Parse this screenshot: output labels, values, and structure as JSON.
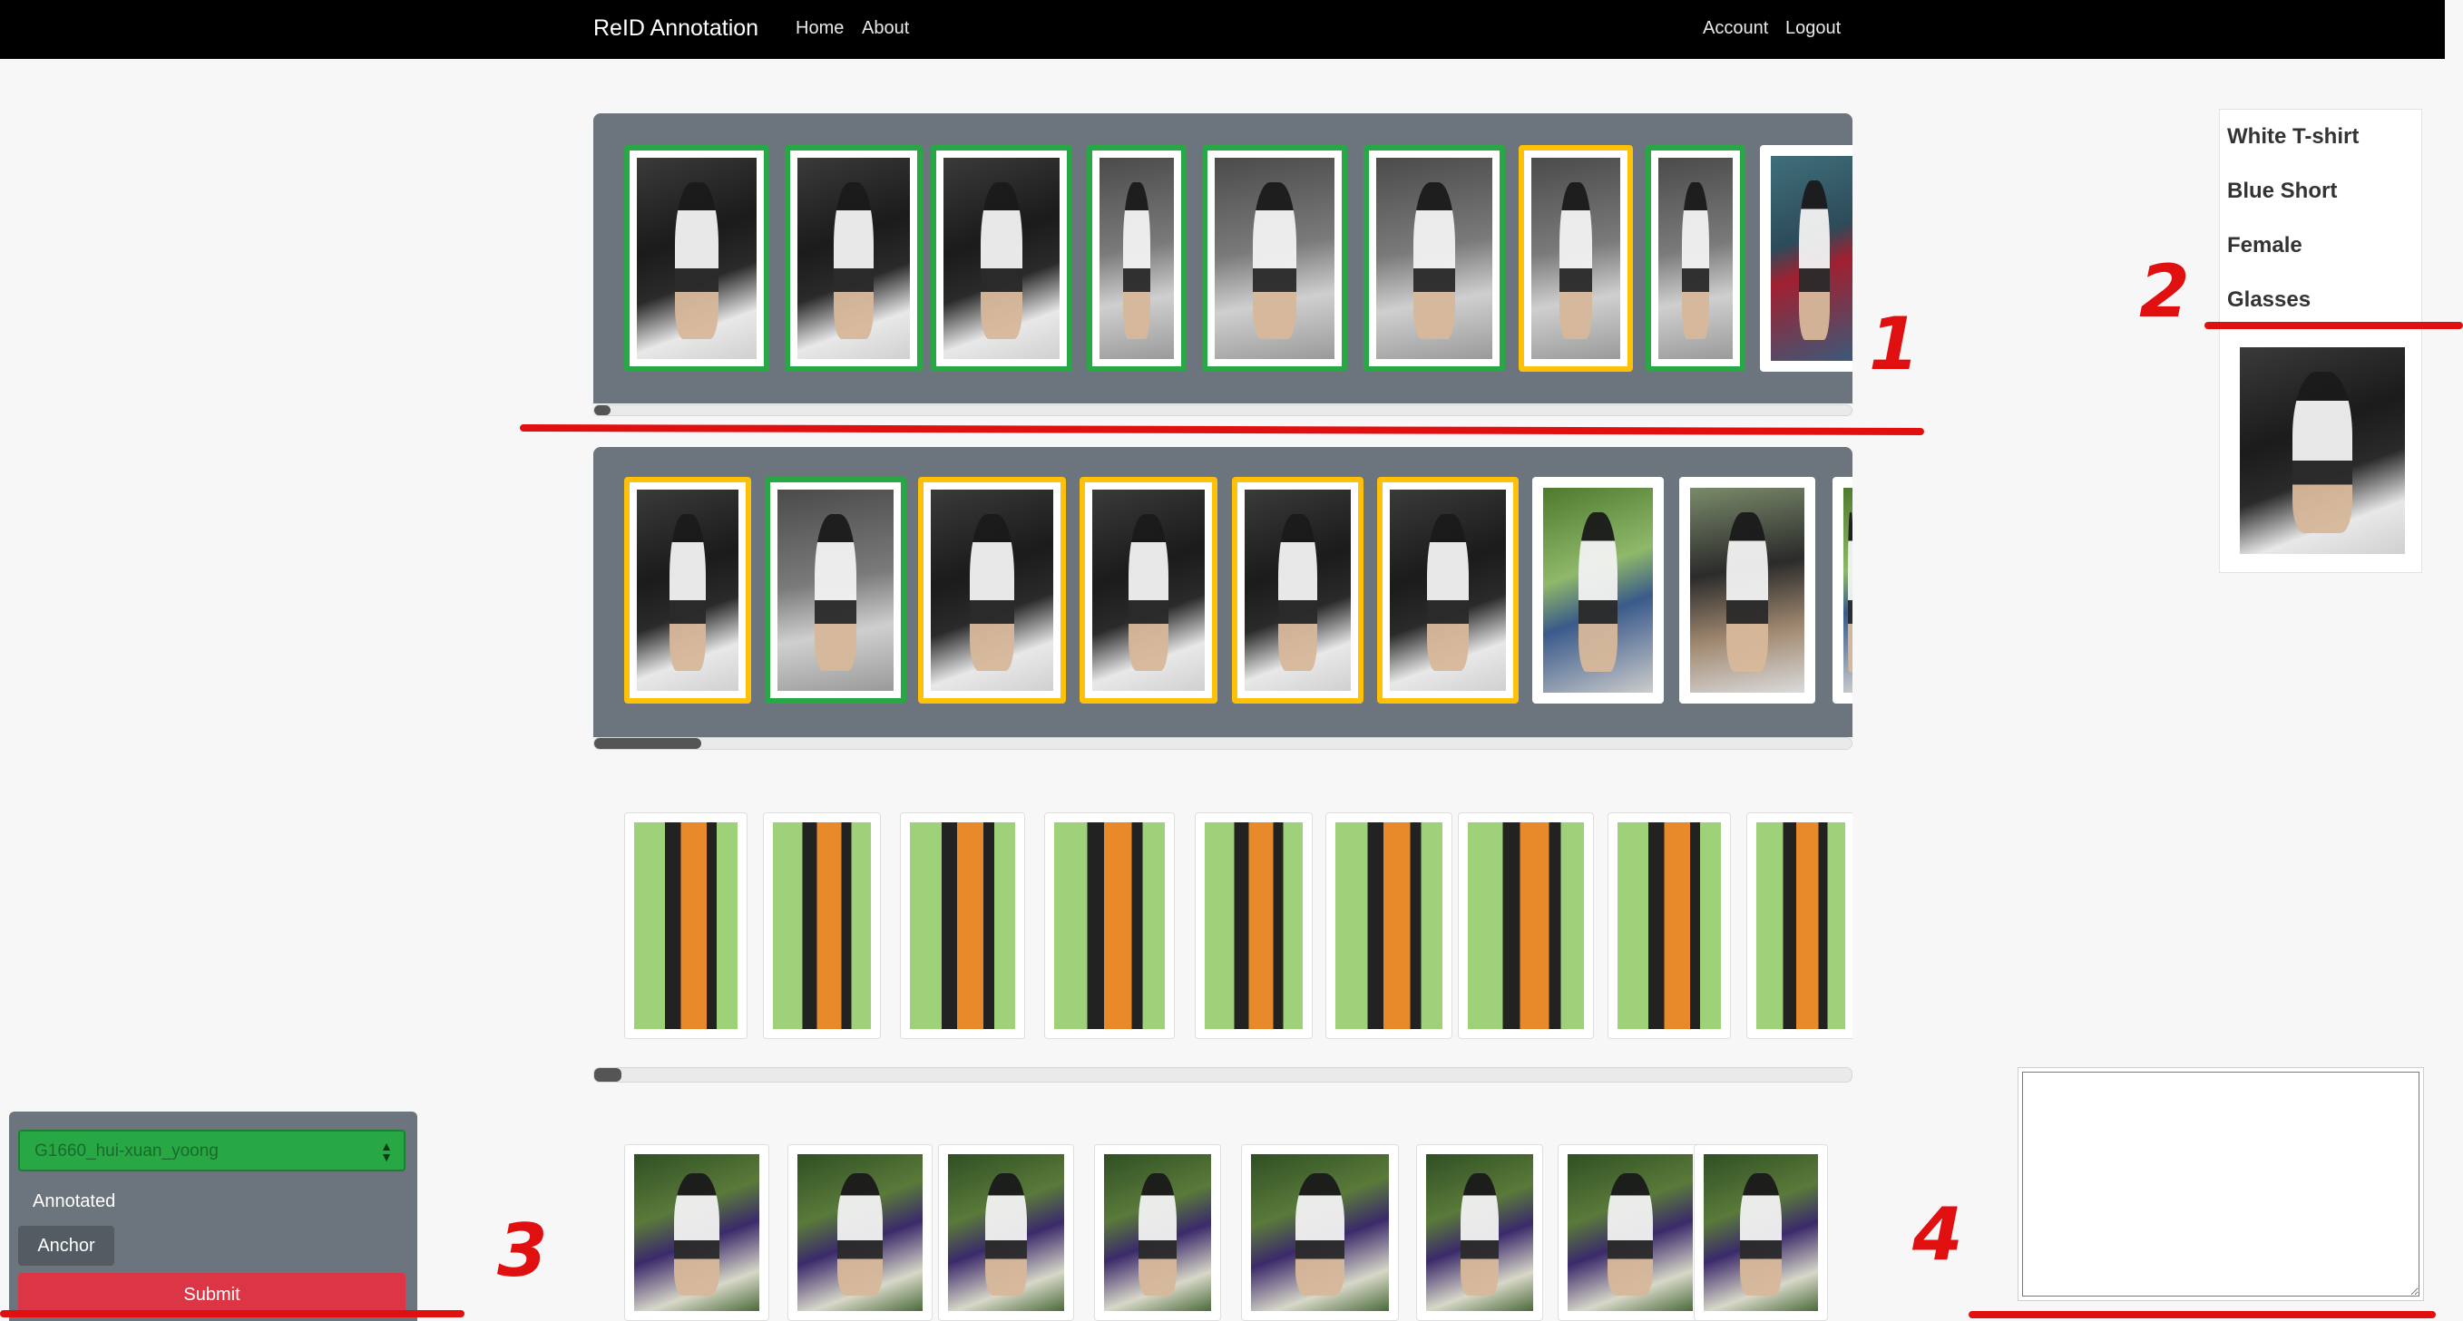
{
  "navbar": {
    "brand": "ReID Annotation",
    "links": [
      "Home",
      "About"
    ],
    "right_links": [
      "Account",
      "Logout"
    ]
  },
  "strips": [
    {
      "scroll_position": 0,
      "cards": [
        {
          "status": "green",
          "scene": "night"
        },
        {
          "status": "green",
          "scene": "night"
        },
        {
          "status": "green",
          "scene": "night"
        },
        {
          "status": "green",
          "scene": "road"
        },
        {
          "status": "green",
          "scene": "road"
        },
        {
          "status": "green",
          "scene": "road"
        },
        {
          "status": "yellow",
          "scene": "road"
        },
        {
          "status": "green",
          "scene": "road"
        },
        {
          "status": "plain",
          "scene": "street"
        }
      ]
    },
    {
      "scroll_position": 0,
      "cards": [
        {
          "status": "yellow",
          "scene": "night"
        },
        {
          "status": "green",
          "scene": "road"
        },
        {
          "status": "yellow",
          "scene": "night"
        },
        {
          "status": "yellow",
          "scene": "night"
        },
        {
          "status": "yellow",
          "scene": "night"
        },
        {
          "status": "yellow",
          "scene": "night"
        },
        {
          "status": "plain",
          "scene": "grass"
        },
        {
          "status": "plain",
          "scene": "stair"
        },
        {
          "status": "plain",
          "scene": "grass"
        }
      ]
    },
    {
      "scroll_position": 0,
      "cards": [
        {
          "status": "light",
          "scene": "sign"
        },
        {
          "status": "light",
          "scene": "sign"
        },
        {
          "status": "light",
          "scene": "sign"
        },
        {
          "status": "light",
          "scene": "sign"
        },
        {
          "status": "light",
          "scene": "sign"
        },
        {
          "status": "light",
          "scene": "sign"
        },
        {
          "status": "light",
          "scene": "sign"
        },
        {
          "status": "light",
          "scene": "sign"
        },
        {
          "status": "light",
          "scene": "sign"
        }
      ]
    },
    {
      "cards": [
        {
          "status": "light",
          "scene": "forest"
        },
        {
          "status": "light",
          "scene": "forest"
        },
        {
          "status": "light",
          "scene": "forest"
        },
        {
          "status": "light",
          "scene": "forest"
        },
        {
          "status": "light",
          "scene": "forest"
        },
        {
          "status": "light",
          "scene": "forest"
        },
        {
          "status": "light",
          "scene": "forest"
        },
        {
          "status": "light",
          "scene": "forest"
        }
      ]
    }
  ],
  "attributes": {
    "items": [
      "White T-shirt",
      "Blue Short",
      "Female",
      "Glasses"
    ]
  },
  "control_panel": {
    "select_value": "G1660_hui-xuan_yoong",
    "annotated_label": "Annotated",
    "anchor_button": "Anchor",
    "submit_button": "Submit"
  },
  "notes": {
    "value": ""
  },
  "markers": [
    "1",
    "2",
    "3",
    "4"
  ],
  "colors": {
    "navbar": "#000000",
    "strip_bg": "#6c757d",
    "match": "#28a745",
    "uncertain": "#ffc107",
    "submit": "#dc3545",
    "marker": "#e01010"
  }
}
